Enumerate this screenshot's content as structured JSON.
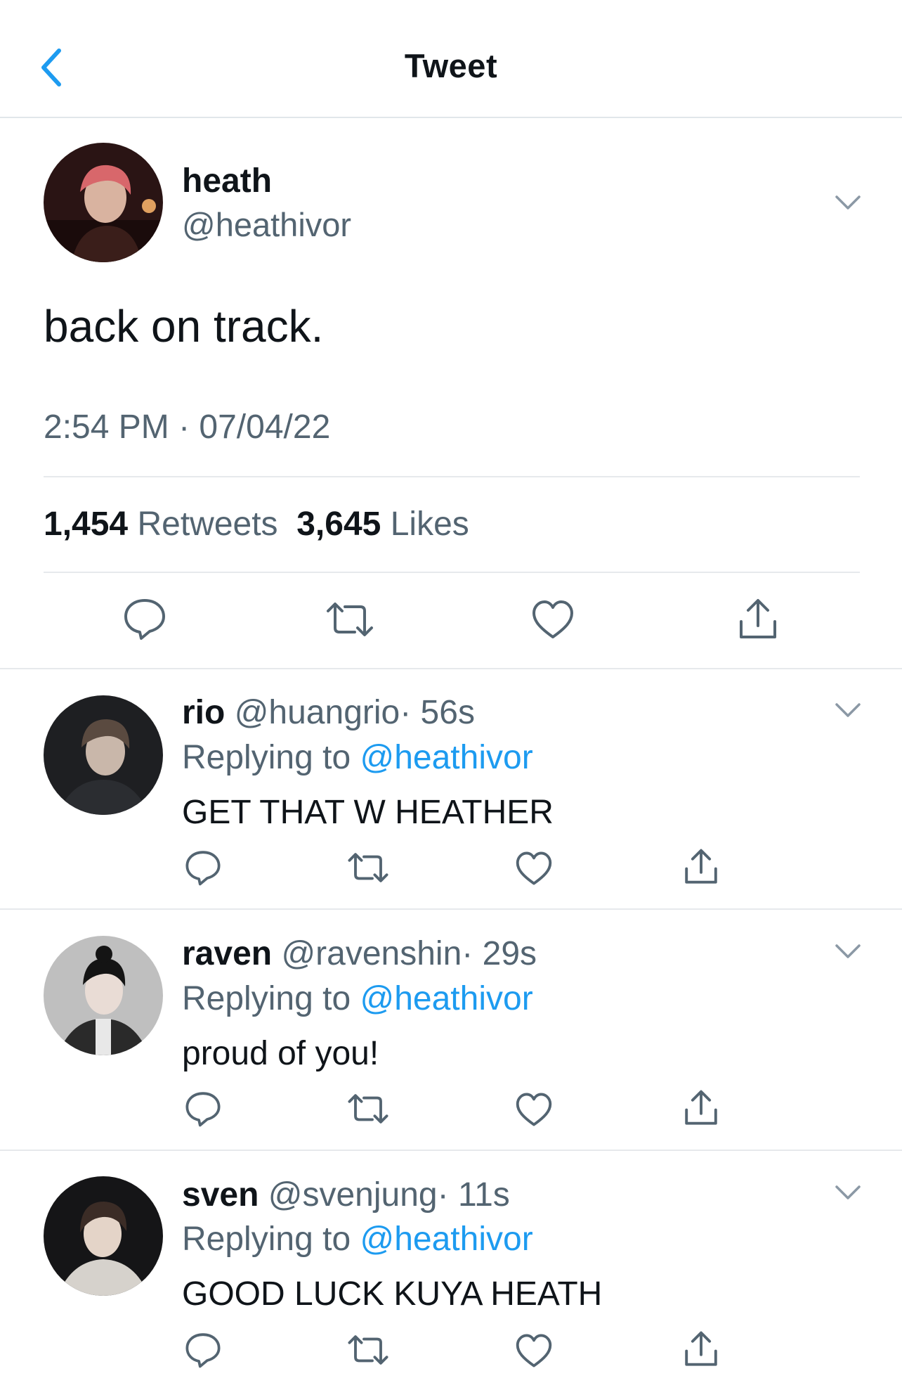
{
  "header": {
    "title": "Tweet"
  },
  "tweet": {
    "name": "heath",
    "handle": "@heathivor",
    "text": "back on track.",
    "timestamp": "2:54 PM · 07/04/22",
    "retweets_count": "1,454",
    "retweets_label": "Retweets",
    "likes_count": "3,645",
    "likes_label": "Likes"
  },
  "replies": [
    {
      "name": "rio",
      "handle": "@huangrio",
      "time": "· 56s",
      "replying_prefix": "Replying to",
      "replying_handle": "@heathivor",
      "text": "GET THAT W HEATHER"
    },
    {
      "name": "raven",
      "handle": "@ravenshin",
      "time": "· 29s",
      "replying_prefix": "Replying to",
      "replying_handle": "@heathivor",
      "text": "proud of you!"
    },
    {
      "name": "sven",
      "handle": "@svenjung",
      "time": "· 11s",
      "replying_prefix": "Replying to",
      "replying_handle": "@heathivor",
      "text": "GOOD LUCK KUYA HEATH"
    }
  ],
  "colors": {
    "accent": "#1d9bf0",
    "secondary_text": "#536471",
    "divider": "#e6e9ec"
  },
  "icons": [
    "back-chevron-icon",
    "chevron-down-icon",
    "reply-icon",
    "retweet-icon",
    "like-icon",
    "share-icon"
  ]
}
